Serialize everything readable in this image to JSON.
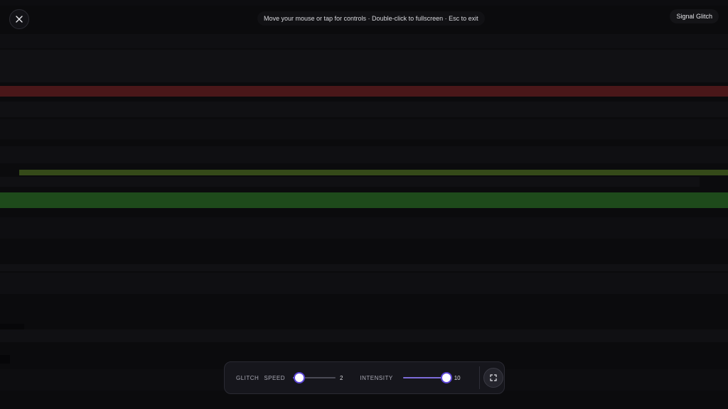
{
  "app": {
    "hint": "Move your mouse or tap for controls · Double-click to fullscreen · Esc to exit",
    "title": "Signal Glitch"
  },
  "icons": {
    "close": "close-icon",
    "fullscreen": "fullscreen-icon"
  },
  "controls": {
    "glitch_label": "GLITCH",
    "speed_label": "SPEED",
    "speed_value": "2",
    "speed_fraction": 0.15,
    "intensity_label": "INTENSITY",
    "intensity_value": "10",
    "intensity_fraction": 1.0
  },
  "colors": {
    "background": "#0b0b0d",
    "accent": "#5b45d6",
    "band_red": "#4a1719",
    "band_green": "#1e4a1b",
    "band_olive": "#354a19"
  }
}
